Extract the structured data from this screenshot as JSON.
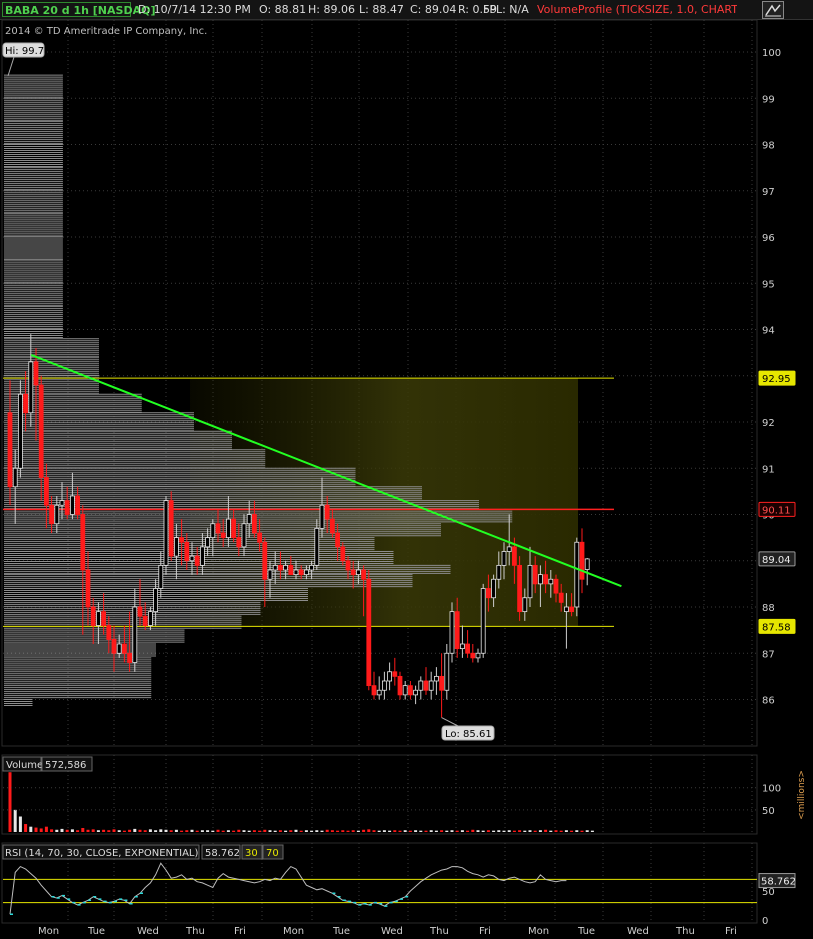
{
  "header": {
    "symbol": "BABA 20 d 1h [NASDAQ]",
    "date": "D: 10/7/14 12:30 PM",
    "open": "O: 88.81",
    "high": "H: 89.06",
    "low": "L: 88.47",
    "close": "C: 89.04",
    "range": "R: 0.59",
    "fpl": "FPL: N/A",
    "study": "VolumeProfile (TICKSIZE, 1.0, CHART, 1, ..."
  },
  "copyright": "2014 © TD Ameritrade IP Company, Inc.",
  "colors": {
    "up": "#e8e8e8",
    "down": "#ff1a1a",
    "trend": "#22ff22",
    "level": "#e6e600",
    "profile": "#8c8c8c",
    "poc": "#ff2020",
    "grid": "#3a3a3a"
  },
  "chart_data": [
    {
      "type": "candlestick",
      "title": "BABA 20 d 1h [NASDAQ]",
      "ylim": [
        85.5,
        100.5
      ],
      "y_ticks": [
        "100",
        "99",
        "98",
        "97",
        "96",
        "95",
        "94",
        "93",
        "92",
        "91",
        "90",
        "89",
        "88",
        "87",
        "86"
      ],
      "x_ticks": [
        "Mon",
        "Tue",
        "Wed",
        "Thu",
        "Fri",
        "Mon",
        "Tue",
        "Wed",
        "Thu",
        "Fri",
        "Mon",
        "Tue",
        "Wed",
        "Thu",
        "Fri"
      ],
      "markers": {
        "hi": "Hi: 99.7",
        "lo": "Lo: 85.61"
      },
      "price_labels": [
        {
          "label": "92.95",
          "value": 92.95,
          "role": "level"
        },
        {
          "label": "90.11",
          "value": 90.11,
          "role": "poc"
        },
        {
          "label": "89.04",
          "value": 89.04,
          "role": "last"
        },
        {
          "label": "87.58",
          "value": 87.58,
          "role": "level"
        }
      ],
      "trendline": [
        {
          "bar": 1,
          "value": 93.45
        },
        {
          "bar": 107,
          "value": 88.45
        }
      ],
      "candles": [
        {
          "o": 92.2,
          "h": 92.9,
          "l": 90.2,
          "c": 90.6
        },
        {
          "o": 90.6,
          "h": 91.4,
          "l": 89.8,
          "c": 91.0
        },
        {
          "o": 91.0,
          "h": 92.9,
          "l": 90.8,
          "c": 92.6
        },
        {
          "o": 92.6,
          "h": 93.1,
          "l": 91.8,
          "c": 92.2
        },
        {
          "o": 92.2,
          "h": 93.9,
          "l": 91.9,
          "c": 93.3
        },
        {
          "o": 93.3,
          "h": 93.6,
          "l": 91.6,
          "c": 92.8
        },
        {
          "o": 92.8,
          "h": 93.0,
          "l": 90.3,
          "c": 90.8
        },
        {
          "o": 90.8,
          "h": 91.1,
          "l": 89.7,
          "c": 90.2
        },
        {
          "o": 90.2,
          "h": 90.4,
          "l": 89.6,
          "c": 89.8
        },
        {
          "o": 89.8,
          "h": 90.4,
          "l": 89.6,
          "c": 90.2
        },
        {
          "o": 90.2,
          "h": 90.7,
          "l": 89.9,
          "c": 90.3
        },
        {
          "o": 90.3,
          "h": 90.6,
          "l": 89.9,
          "c": 90.0
        },
        {
          "o": 90.0,
          "h": 90.9,
          "l": 89.9,
          "c": 90.4
        },
        {
          "o": 90.4,
          "h": 90.6,
          "l": 89.9,
          "c": 90.0
        },
        {
          "o": 90.0,
          "h": 90.2,
          "l": 87.4,
          "c": 88.8
        },
        {
          "o": 88.8,
          "h": 89.2,
          "l": 87.6,
          "c": 88.0
        },
        {
          "o": 88.0,
          "h": 88.2,
          "l": 87.2,
          "c": 87.6
        },
        {
          "o": 87.6,
          "h": 88.1,
          "l": 87.2,
          "c": 87.9
        },
        {
          "o": 87.9,
          "h": 88.3,
          "l": 87.4,
          "c": 87.6
        },
        {
          "o": 87.6,
          "h": 87.8,
          "l": 87.0,
          "c": 87.3
        },
        {
          "o": 87.3,
          "h": 87.6,
          "l": 86.6,
          "c": 87.0
        },
        {
          "o": 87.0,
          "h": 87.4,
          "l": 86.9,
          "c": 87.2
        },
        {
          "o": 87.2,
          "h": 87.6,
          "l": 86.8,
          "c": 87.0
        },
        {
          "o": 87.0,
          "h": 87.9,
          "l": 86.6,
          "c": 86.8
        },
        {
          "o": 86.8,
          "h": 88.4,
          "l": 86.6,
          "c": 88.0
        },
        {
          "o": 88.0,
          "h": 88.6,
          "l": 87.6,
          "c": 87.8
        },
        {
          "o": 87.8,
          "h": 88.1,
          "l": 87.5,
          "c": 87.6
        },
        {
          "o": 87.6,
          "h": 88.0,
          "l": 87.5,
          "c": 87.9
        },
        {
          "o": 87.9,
          "h": 88.6,
          "l": 87.6,
          "c": 88.4
        },
        {
          "o": 88.4,
          "h": 89.2,
          "l": 88.2,
          "c": 88.9
        },
        {
          "o": 88.9,
          "h": 90.4,
          "l": 88.7,
          "c": 90.3
        },
        {
          "o": 90.3,
          "h": 90.5,
          "l": 89.0,
          "c": 89.1
        },
        {
          "o": 89.1,
          "h": 89.8,
          "l": 88.6,
          "c": 89.5
        },
        {
          "o": 89.5,
          "h": 89.9,
          "l": 88.9,
          "c": 89.4
        },
        {
          "o": 89.4,
          "h": 89.6,
          "l": 88.8,
          "c": 89.0
        },
        {
          "o": 89.0,
          "h": 89.4,
          "l": 88.7,
          "c": 89.1
        },
        {
          "o": 89.1,
          "h": 89.3,
          "l": 88.7,
          "c": 88.9
        },
        {
          "o": 88.9,
          "h": 89.6,
          "l": 88.7,
          "c": 89.3
        },
        {
          "o": 89.3,
          "h": 89.7,
          "l": 89.1,
          "c": 89.5
        },
        {
          "o": 89.5,
          "h": 89.9,
          "l": 89.1,
          "c": 89.8
        },
        {
          "o": 89.8,
          "h": 90.1,
          "l": 89.4,
          "c": 89.6
        },
        {
          "o": 89.6,
          "h": 89.9,
          "l": 89.3,
          "c": 89.5
        },
        {
          "o": 89.5,
          "h": 90.4,
          "l": 89.3,
          "c": 89.9
        },
        {
          "o": 89.9,
          "h": 90.1,
          "l": 89.4,
          "c": 89.5
        },
        {
          "o": 89.5,
          "h": 89.8,
          "l": 89.1,
          "c": 89.3
        },
        {
          "o": 89.3,
          "h": 90.0,
          "l": 89.1,
          "c": 89.8
        },
        {
          "o": 89.8,
          "h": 90.3,
          "l": 89.5,
          "c": 90.0
        },
        {
          "o": 90.0,
          "h": 90.3,
          "l": 89.5,
          "c": 89.6
        },
        {
          "o": 89.6,
          "h": 89.9,
          "l": 89.2,
          "c": 89.4
        },
        {
          "o": 89.4,
          "h": 89.5,
          "l": 88.0,
          "c": 88.6
        },
        {
          "o": 88.6,
          "h": 89.0,
          "l": 88.2,
          "c": 88.8
        },
        {
          "o": 88.8,
          "h": 89.2,
          "l": 88.5,
          "c": 88.9
        },
        {
          "o": 88.9,
          "h": 89.2,
          "l": 88.6,
          "c": 88.8
        },
        {
          "o": 88.8,
          "h": 89.0,
          "l": 88.6,
          "c": 88.9
        },
        {
          "o": 88.9,
          "h": 89.1,
          "l": 88.7,
          "c": 88.7
        },
        {
          "o": 88.7,
          "h": 89.0,
          "l": 88.6,
          "c": 88.8
        },
        {
          "o": 88.8,
          "h": 88.9,
          "l": 88.6,
          "c": 88.7
        },
        {
          "o": 88.7,
          "h": 88.9,
          "l": 88.6,
          "c": 88.8
        },
        {
          "o": 88.8,
          "h": 89.0,
          "l": 88.6,
          "c": 88.9
        },
        {
          "o": 88.9,
          "h": 89.9,
          "l": 88.8,
          "c": 89.7
        },
        {
          "o": 89.7,
          "h": 90.8,
          "l": 89.5,
          "c": 90.2
        },
        {
          "o": 90.2,
          "h": 90.4,
          "l": 89.6,
          "c": 89.9
        },
        {
          "o": 89.9,
          "h": 90.1,
          "l": 89.5,
          "c": 89.6
        },
        {
          "o": 89.6,
          "h": 89.8,
          "l": 89.0,
          "c": 89.3
        },
        {
          "o": 89.3,
          "h": 89.4,
          "l": 88.9,
          "c": 89.0
        },
        {
          "o": 89.0,
          "h": 89.1,
          "l": 88.6,
          "c": 88.8
        },
        {
          "o": 88.8,
          "h": 89.0,
          "l": 88.4,
          "c": 88.7
        },
        {
          "o": 88.7,
          "h": 89.0,
          "l": 88.5,
          "c": 88.8
        },
        {
          "o": 88.8,
          "h": 88.9,
          "l": 87.8,
          "c": 88.6
        },
        {
          "o": 88.6,
          "h": 88.8,
          "l": 86.2,
          "c": 86.3
        },
        {
          "o": 86.3,
          "h": 86.6,
          "l": 86.0,
          "c": 86.1
        },
        {
          "o": 86.1,
          "h": 86.5,
          "l": 86.0,
          "c": 86.2
        },
        {
          "o": 86.2,
          "h": 86.6,
          "l": 86.0,
          "c": 86.4
        },
        {
          "o": 86.4,
          "h": 86.8,
          "l": 86.2,
          "c": 86.6
        },
        {
          "o": 86.6,
          "h": 86.9,
          "l": 86.3,
          "c": 86.5
        },
        {
          "o": 86.5,
          "h": 86.6,
          "l": 86.0,
          "c": 86.1
        },
        {
          "o": 86.1,
          "h": 86.4,
          "l": 86.0,
          "c": 86.3
        },
        {
          "o": 86.3,
          "h": 86.4,
          "l": 86.0,
          "c": 86.1
        },
        {
          "o": 86.1,
          "h": 86.3,
          "l": 85.9,
          "c": 86.2
        },
        {
          "o": 86.2,
          "h": 86.5,
          "l": 86.0,
          "c": 86.4
        },
        {
          "o": 86.4,
          "h": 86.7,
          "l": 86.1,
          "c": 86.2
        },
        {
          "o": 86.2,
          "h": 86.6,
          "l": 86.0,
          "c": 86.4
        },
        {
          "o": 86.4,
          "h": 86.7,
          "l": 86.1,
          "c": 86.5
        },
        {
          "o": 86.5,
          "h": 87.0,
          "l": 85.61,
          "c": 86.2
        },
        {
          "o": 86.2,
          "h": 87.2,
          "l": 86.0,
          "c": 87.0
        },
        {
          "o": 87.0,
          "h": 88.1,
          "l": 86.8,
          "c": 87.9
        },
        {
          "o": 87.9,
          "h": 88.2,
          "l": 86.9,
          "c": 87.1
        },
        {
          "o": 87.1,
          "h": 87.6,
          "l": 86.9,
          "c": 87.2
        },
        {
          "o": 87.2,
          "h": 87.5,
          "l": 86.9,
          "c": 87.0
        },
        {
          "o": 87.0,
          "h": 87.2,
          "l": 86.8,
          "c": 86.9
        },
        {
          "o": 86.9,
          "h": 87.1,
          "l": 86.8,
          "c": 87.0
        },
        {
          "o": 87.0,
          "h": 88.5,
          "l": 86.9,
          "c": 88.4
        },
        {
          "o": 88.4,
          "h": 88.7,
          "l": 87.9,
          "c": 88.2
        },
        {
          "o": 88.2,
          "h": 88.7,
          "l": 88.0,
          "c": 88.6
        },
        {
          "o": 88.6,
          "h": 89.2,
          "l": 88.4,
          "c": 88.9
        },
        {
          "o": 88.9,
          "h": 89.4,
          "l": 88.6,
          "c": 89.2
        },
        {
          "o": 89.2,
          "h": 90.0,
          "l": 88.9,
          "c": 89.3
        },
        {
          "o": 89.3,
          "h": 89.5,
          "l": 88.5,
          "c": 88.9
        },
        {
          "o": 88.9,
          "h": 89.1,
          "l": 87.7,
          "c": 87.9
        },
        {
          "o": 87.9,
          "h": 88.4,
          "l": 87.7,
          "c": 88.2
        },
        {
          "o": 88.2,
          "h": 89.3,
          "l": 88.0,
          "c": 88.9
        },
        {
          "o": 88.9,
          "h": 89.1,
          "l": 88.3,
          "c": 88.5
        },
        {
          "o": 88.5,
          "h": 88.9,
          "l": 88.0,
          "c": 88.7
        },
        {
          "o": 88.7,
          "h": 89.0,
          "l": 88.3,
          "c": 88.5
        },
        {
          "o": 88.5,
          "h": 88.8,
          "l": 88.2,
          "c": 88.6
        },
        {
          "o": 88.6,
          "h": 88.7,
          "l": 88.1,
          "c": 88.3
        },
        {
          "o": 88.3,
          "h": 88.5,
          "l": 87.9,
          "c": 88.1
        },
        {
          "o": 87.9,
          "h": 88.3,
          "l": 87.1,
          "c": 88.0
        },
        {
          "o": 88.0,
          "h": 88.3,
          "l": 87.8,
          "c": 87.9
        },
        {
          "o": 88.0,
          "h": 89.5,
          "l": 87.8,
          "c": 89.4
        },
        {
          "o": 89.4,
          "h": 89.7,
          "l": 88.3,
          "c": 88.6
        },
        {
          "o": 88.81,
          "h": 89.06,
          "l": 88.47,
          "c": 89.04
        }
      ],
      "volume_profile": [
        {
          "price": 99.5,
          "size": 0.62
        },
        {
          "price": 99.0,
          "size": 0.62
        },
        {
          "price": 98.5,
          "size": 0.62
        },
        {
          "price": 98.0,
          "size": 0.62
        },
        {
          "price": 97.5,
          "size": 0.62
        },
        {
          "price": 97.0,
          "size": 0.62
        },
        {
          "price": 96.5,
          "size": 0.62
        },
        {
          "price": 96.0,
          "size": 0.62
        },
        {
          "price": 95.5,
          "size": 0.62
        },
        {
          "price": 95.0,
          "size": 0.62
        },
        {
          "price": 94.5,
          "size": 0.62
        },
        {
          "price": 94.0,
          "size": 0.62
        },
        {
          "price": 93.8,
          "size": 1.0
        },
        {
          "price": 93.4,
          "size": 1.0
        },
        {
          "price": 93.0,
          "size": 1.0
        },
        {
          "price": 92.6,
          "size": 1.45
        },
        {
          "price": 92.2,
          "size": 2.0
        },
        {
          "price": 91.8,
          "size": 2.4
        },
        {
          "price": 91.4,
          "size": 2.75
        },
        {
          "price": 91.0,
          "size": 3.7
        },
        {
          "price": 90.6,
          "size": 4.4
        },
        {
          "price": 90.3,
          "size": 5.0
        },
        {
          "price": 90.1,
          "size": 5.35
        },
        {
          "price": 89.8,
          "size": 4.6
        },
        {
          "price": 89.5,
          "size": 3.9
        },
        {
          "price": 89.2,
          "size": 4.1
        },
        {
          "price": 88.9,
          "size": 4.7
        },
        {
          "price": 88.7,
          "size": 4.3
        },
        {
          "price": 88.4,
          "size": 3.2
        },
        {
          "price": 88.1,
          "size": 2.7
        },
        {
          "price": 87.8,
          "size": 2.5
        },
        {
          "price": 87.5,
          "size": 1.9
        },
        {
          "price": 87.2,
          "size": 1.6
        },
        {
          "price": 86.9,
          "size": 1.55
        },
        {
          "price": 86.6,
          "size": 1.55
        },
        {
          "price": 86.3,
          "size": 1.55
        },
        {
          "price": 86.0,
          "size": 0.3
        }
      ]
    },
    {
      "type": "bar",
      "title": "Volume",
      "last_value": "572,586",
      "ylabel": "<millions>",
      "y_ticks": [
        "100",
        "50"
      ],
      "ylim": [
        0,
        140
      ],
      "values": [
        135,
        50,
        35,
        18,
        12,
        10,
        8,
        12,
        6,
        5,
        7,
        5,
        6,
        4,
        9,
        5,
        6,
        4,
        5,
        4,
        6,
        4,
        3,
        5,
        7,
        5,
        4,
        6,
        4,
        6,
        5,
        4,
        5,
        3,
        4,
        5,
        3,
        4,
        4,
        3,
        5,
        3,
        4,
        3,
        5,
        4,
        3,
        4,
        3,
        5,
        4,
        3,
        4,
        3,
        4,
        5,
        3,
        4,
        3,
        4,
        3,
        5,
        4,
        3,
        4,
        3,
        4,
        3,
        5,
        6,
        4,
        3,
        4,
        3,
        4,
        3,
        4,
        3,
        4,
        3,
        3,
        4,
        3,
        4,
        3,
        4,
        3,
        4,
        3,
        5,
        4,
        3,
        4,
        3,
        4,
        3,
        4,
        3,
        4,
        3,
        4,
        3,
        4,
        5,
        3,
        4,
        3,
        4,
        3,
        4,
        3,
        4,
        3
      ]
    },
    {
      "type": "line",
      "title": "RSI (14, 70, 30, CLOSE, EXPONENTIAL)",
      "last_value": "58.762",
      "levels": [
        "30",
        "70"
      ],
      "y_ticks": [
        "50",
        "0"
      ],
      "ylim": [
        0,
        100
      ],
      "values": [
        10,
        82,
        92,
        88,
        80,
        72,
        60,
        50,
        40,
        38,
        42,
        36,
        30,
        26,
        30,
        34,
        40,
        36,
        32,
        30,
        32,
        36,
        34,
        28,
        40,
        46,
        56,
        64,
        78,
        98,
        86,
        72,
        74,
        78,
        70,
        72,
        66,
        64,
        60,
        56,
        72,
        80,
        74,
        72,
        70,
        68,
        66,
        64,
        66,
        70,
        68,
        72,
        70,
        82,
        92,
        88,
        74,
        60,
        56,
        52,
        54,
        50,
        46,
        40,
        34,
        32,
        30,
        26,
        28,
        26,
        30,
        28,
        24,
        30,
        32,
        36,
        40,
        50,
        58,
        66,
        72,
        78,
        82,
        86,
        88,
        92,
        92,
        90,
        84,
        80,
        78,
        74,
        78,
        76,
        70,
        68,
        72,
        74,
        70,
        66,
        64,
        66,
        78,
        70,
        68,
        66,
        68,
        68
      ]
    }
  ]
}
